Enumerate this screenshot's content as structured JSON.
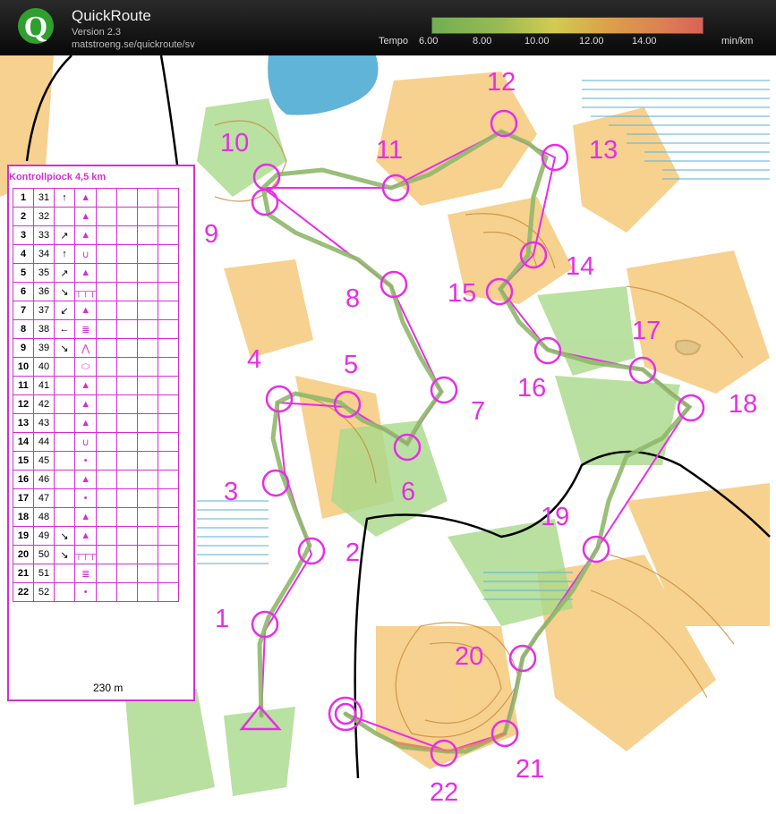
{
  "app": {
    "title": "QuickRoute",
    "version": "Version 2.3",
    "url": "matstroeng.se/quickroute/sv"
  },
  "tempo": {
    "label": "Tempo",
    "ticks": [
      "6.00",
      "8.00",
      "10.00",
      "12.00",
      "14.00"
    ],
    "unit": "min/km"
  },
  "legend": {
    "title": "Kontrollpiock   4,5 km",
    "distance": "230 m",
    "rows": [
      {
        "n": "1",
        "code": "31",
        "dir": "↑",
        "sym": "▲"
      },
      {
        "n": "2",
        "code": "32",
        "dir": "",
        "sym": "▲"
      },
      {
        "n": "3",
        "code": "33",
        "dir": "↗",
        "sym": "▲"
      },
      {
        "n": "4",
        "code": "34",
        "dir": "↑",
        "sym": "∪"
      },
      {
        "n": "5",
        "code": "35",
        "dir": "↗",
        "sym": "▲"
      },
      {
        "n": "6",
        "code": "36",
        "dir": "↘",
        "sym": "┬┬┬"
      },
      {
        "n": "7",
        "code": "37",
        "dir": "↙",
        "sym": "▲"
      },
      {
        "n": "8",
        "code": "38",
        "dir": "←",
        "sym": "≣"
      },
      {
        "n": "9",
        "code": "39",
        "dir": "↘",
        "sym": "⋀"
      },
      {
        "n": "10",
        "code": "40",
        "dir": "",
        "sym": "⬭"
      },
      {
        "n": "11",
        "code": "41",
        "dir": "",
        "sym": "▲"
      },
      {
        "n": "12",
        "code": "42",
        "dir": "",
        "sym": "▲"
      },
      {
        "n": "13",
        "code": "43",
        "dir": "",
        "sym": "▲"
      },
      {
        "n": "14",
        "code": "44",
        "dir": "",
        "sym": "∪"
      },
      {
        "n": "15",
        "code": "45",
        "dir": "",
        "sym": "•"
      },
      {
        "n": "16",
        "code": "46",
        "dir": "",
        "sym": "▲"
      },
      {
        "n": "17",
        "code": "47",
        "dir": "",
        "sym": "•"
      },
      {
        "n": "18",
        "code": "48",
        "dir": "",
        "sym": "▲"
      },
      {
        "n": "19",
        "code": "49",
        "dir": "↘",
        "sym": "▲"
      },
      {
        "n": "20",
        "code": "50",
        "dir": "↘",
        "sym": "┬┬┬"
      },
      {
        "n": "21",
        "code": "51",
        "dir": "",
        "sym": "≣"
      },
      {
        "n": "22",
        "code": "52",
        "dir": "",
        "sym": "•"
      }
    ]
  },
  "controls": [
    "1",
    "2",
    "3",
    "4",
    "5",
    "6",
    "7",
    "8",
    "9",
    "10",
    "11",
    "12",
    "13",
    "14",
    "15",
    "16",
    "17",
    "18",
    "19",
    "20",
    "21",
    "22"
  ],
  "colors": {
    "course": "#e62ee6",
    "water": "#5fb4d8",
    "forest": "#ffffff",
    "open": "#f6c97b",
    "green": "#a8d98a"
  }
}
